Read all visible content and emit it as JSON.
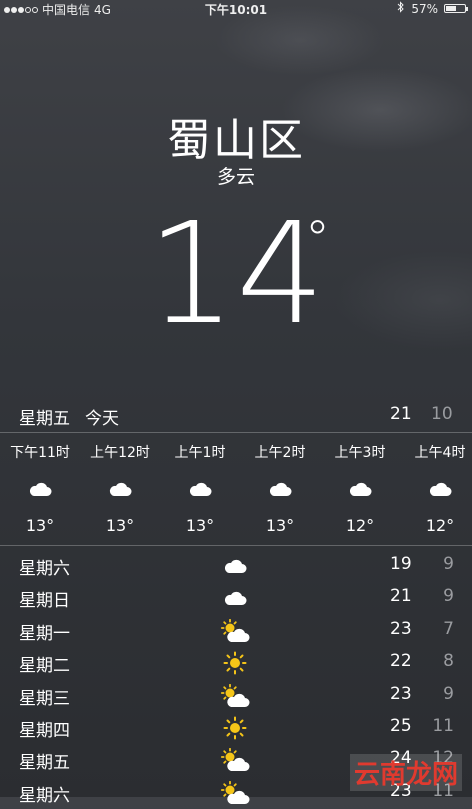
{
  "status_bar": {
    "carrier": "中国电信",
    "network": "4G",
    "time": "下午10:01",
    "battery_percent": "57%",
    "battery_level": 0.57,
    "signal_bars_filled": 3,
    "signal_bars_total": 5
  },
  "location": {
    "city": "蜀山区",
    "condition": "多云"
  },
  "current": {
    "temperature": "14",
    "unit": "°"
  },
  "today": {
    "day": "星期五",
    "label": "今天",
    "high": "21",
    "low": "10"
  },
  "hourly": [
    {
      "time": "下午11时",
      "icon": "cloud-icon",
      "temp": "13°"
    },
    {
      "time": "上午12时",
      "icon": "cloud-icon",
      "temp": "13°"
    },
    {
      "time": "上午1时",
      "icon": "cloud-icon",
      "temp": "13°"
    },
    {
      "time": "上午2时",
      "icon": "cloud-icon",
      "temp": "13°"
    },
    {
      "time": "上午3时",
      "icon": "cloud-icon",
      "temp": "12°"
    },
    {
      "time": "上午4时",
      "icon": "cloud-icon",
      "temp": "12°"
    }
  ],
  "daily": [
    {
      "day": "星期六",
      "icon": "cloud-icon",
      "high": "19",
      "low": "9"
    },
    {
      "day": "星期日",
      "icon": "cloud-icon",
      "high": "21",
      "low": "9"
    },
    {
      "day": "星期一",
      "icon": "partly-cloudy-icon",
      "high": "23",
      "low": "7"
    },
    {
      "day": "星期二",
      "icon": "sun-icon",
      "high": "22",
      "low": "8"
    },
    {
      "day": "星期三",
      "icon": "partly-cloudy-icon",
      "high": "23",
      "low": "9"
    },
    {
      "day": "星期四",
      "icon": "sun-icon",
      "high": "25",
      "low": "11"
    },
    {
      "day": "星期五",
      "icon": "partly-cloudy-icon",
      "high": "24",
      "low": "12"
    },
    {
      "day": "星期六",
      "icon": "partly-cloudy-icon",
      "high": "23",
      "low": "11"
    }
  ],
  "watermark": "云南龙网",
  "colors": {
    "sun": "#f5c518",
    "low_temp": "#9a9ca0",
    "watermark": "#e03a2f"
  }
}
